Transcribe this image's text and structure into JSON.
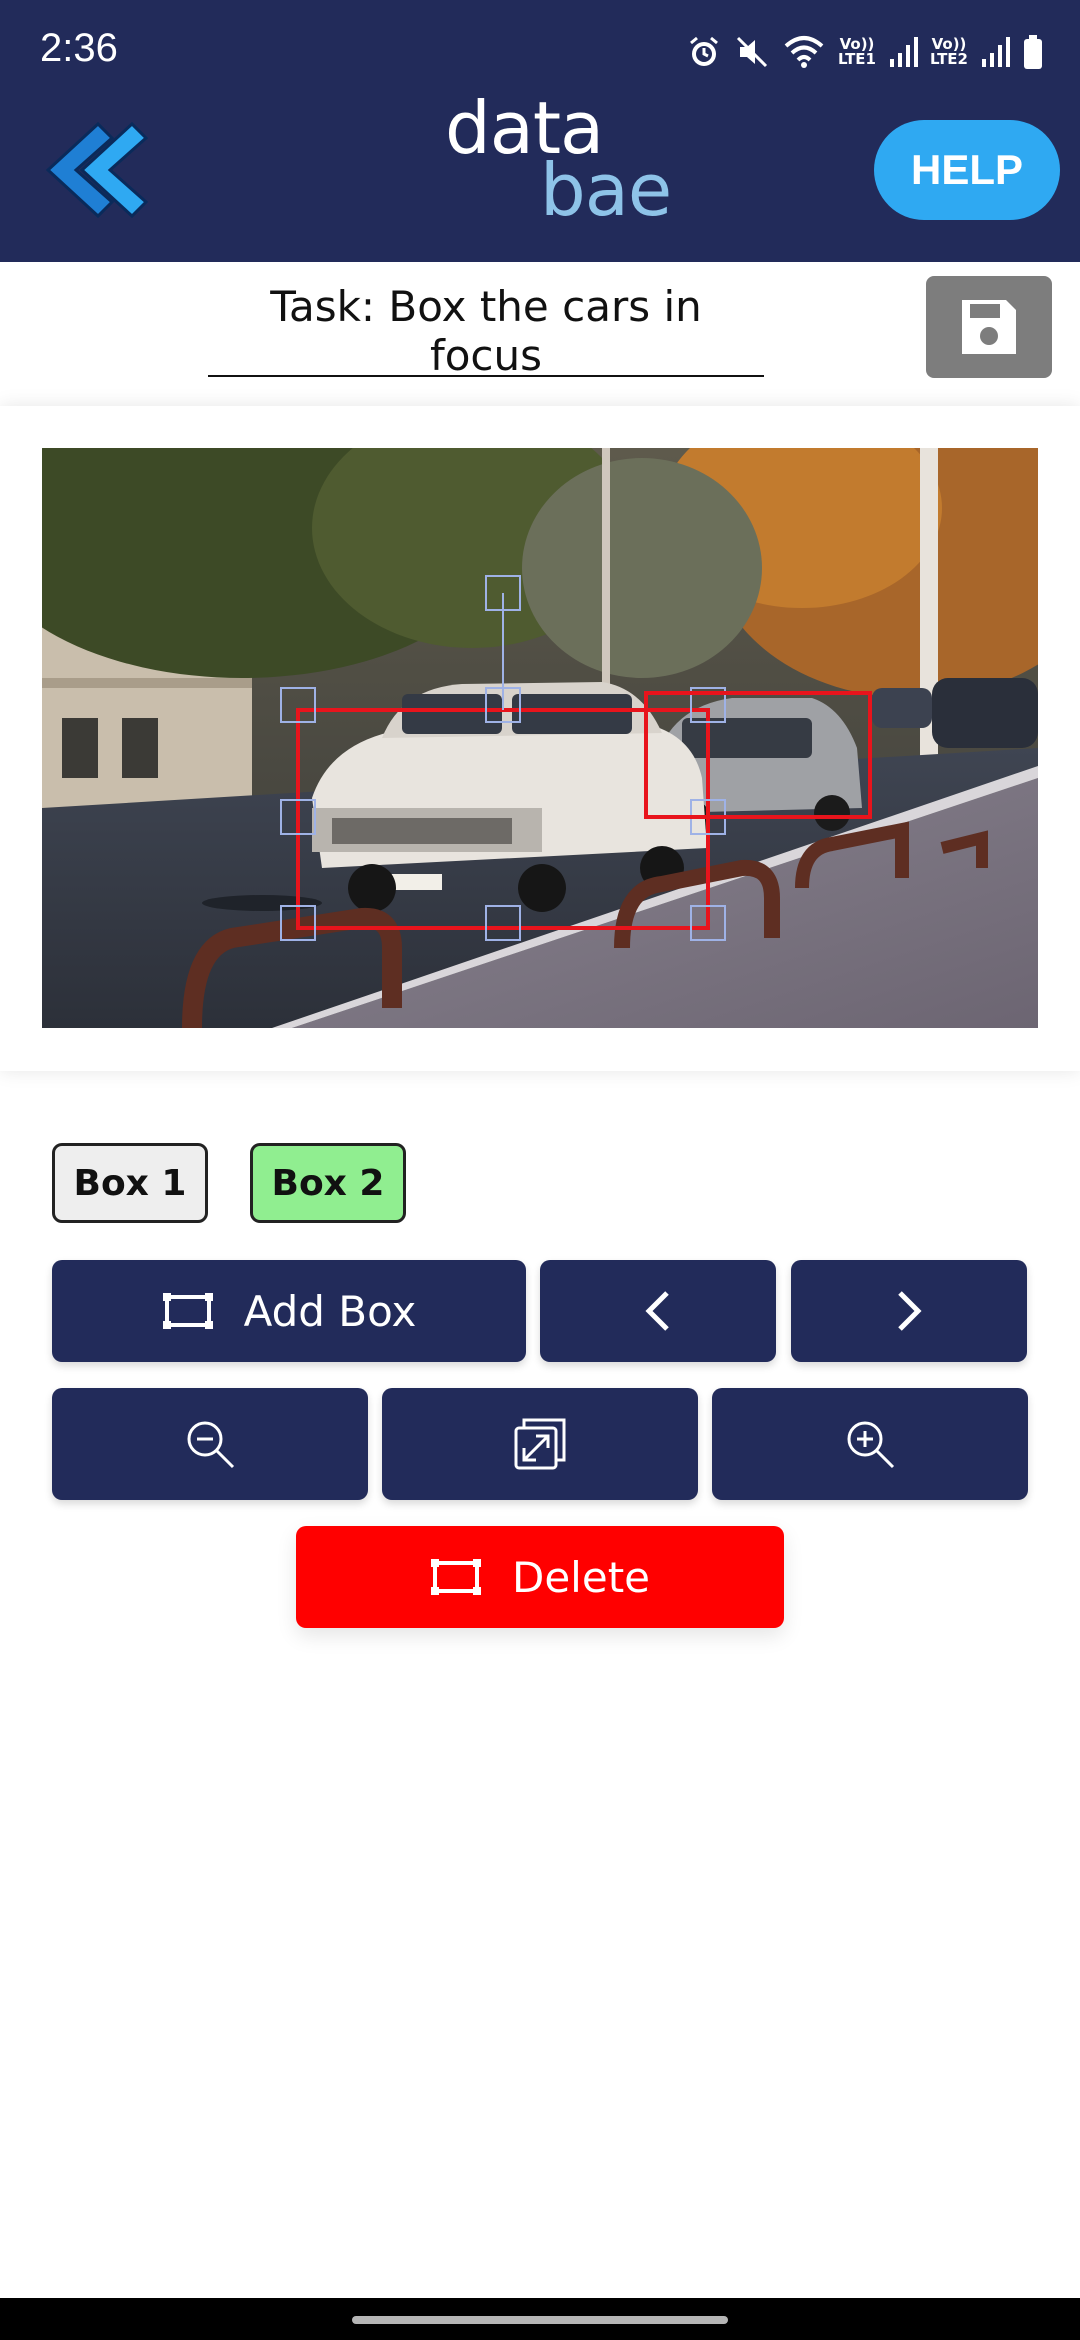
{
  "status_bar": {
    "time": "2:36",
    "lte1_top": "Vo))",
    "lte1_bottom": "LTE1",
    "lte2_top": "Vo))",
    "lte2_bottom": "LTE2"
  },
  "header": {
    "logo_top": "data",
    "logo_bottom": "bae",
    "help_label": "HELP"
  },
  "task": {
    "title": "Task: Box the cars in focus"
  },
  "boxes": {
    "items": [
      {
        "label": "Box 1",
        "selected": false
      },
      {
        "label": "Box 2",
        "selected": true
      }
    ]
  },
  "toolbar": {
    "add_box_label": "Add Box",
    "delete_label": "Delete"
  },
  "colors": {
    "primary": "#222b5a",
    "accent": "#2fa9f2",
    "selected_chip": "#90ee90",
    "delete": "#ff0000",
    "box_stroke": "#e8141c",
    "handle": "#9fb2e6"
  }
}
